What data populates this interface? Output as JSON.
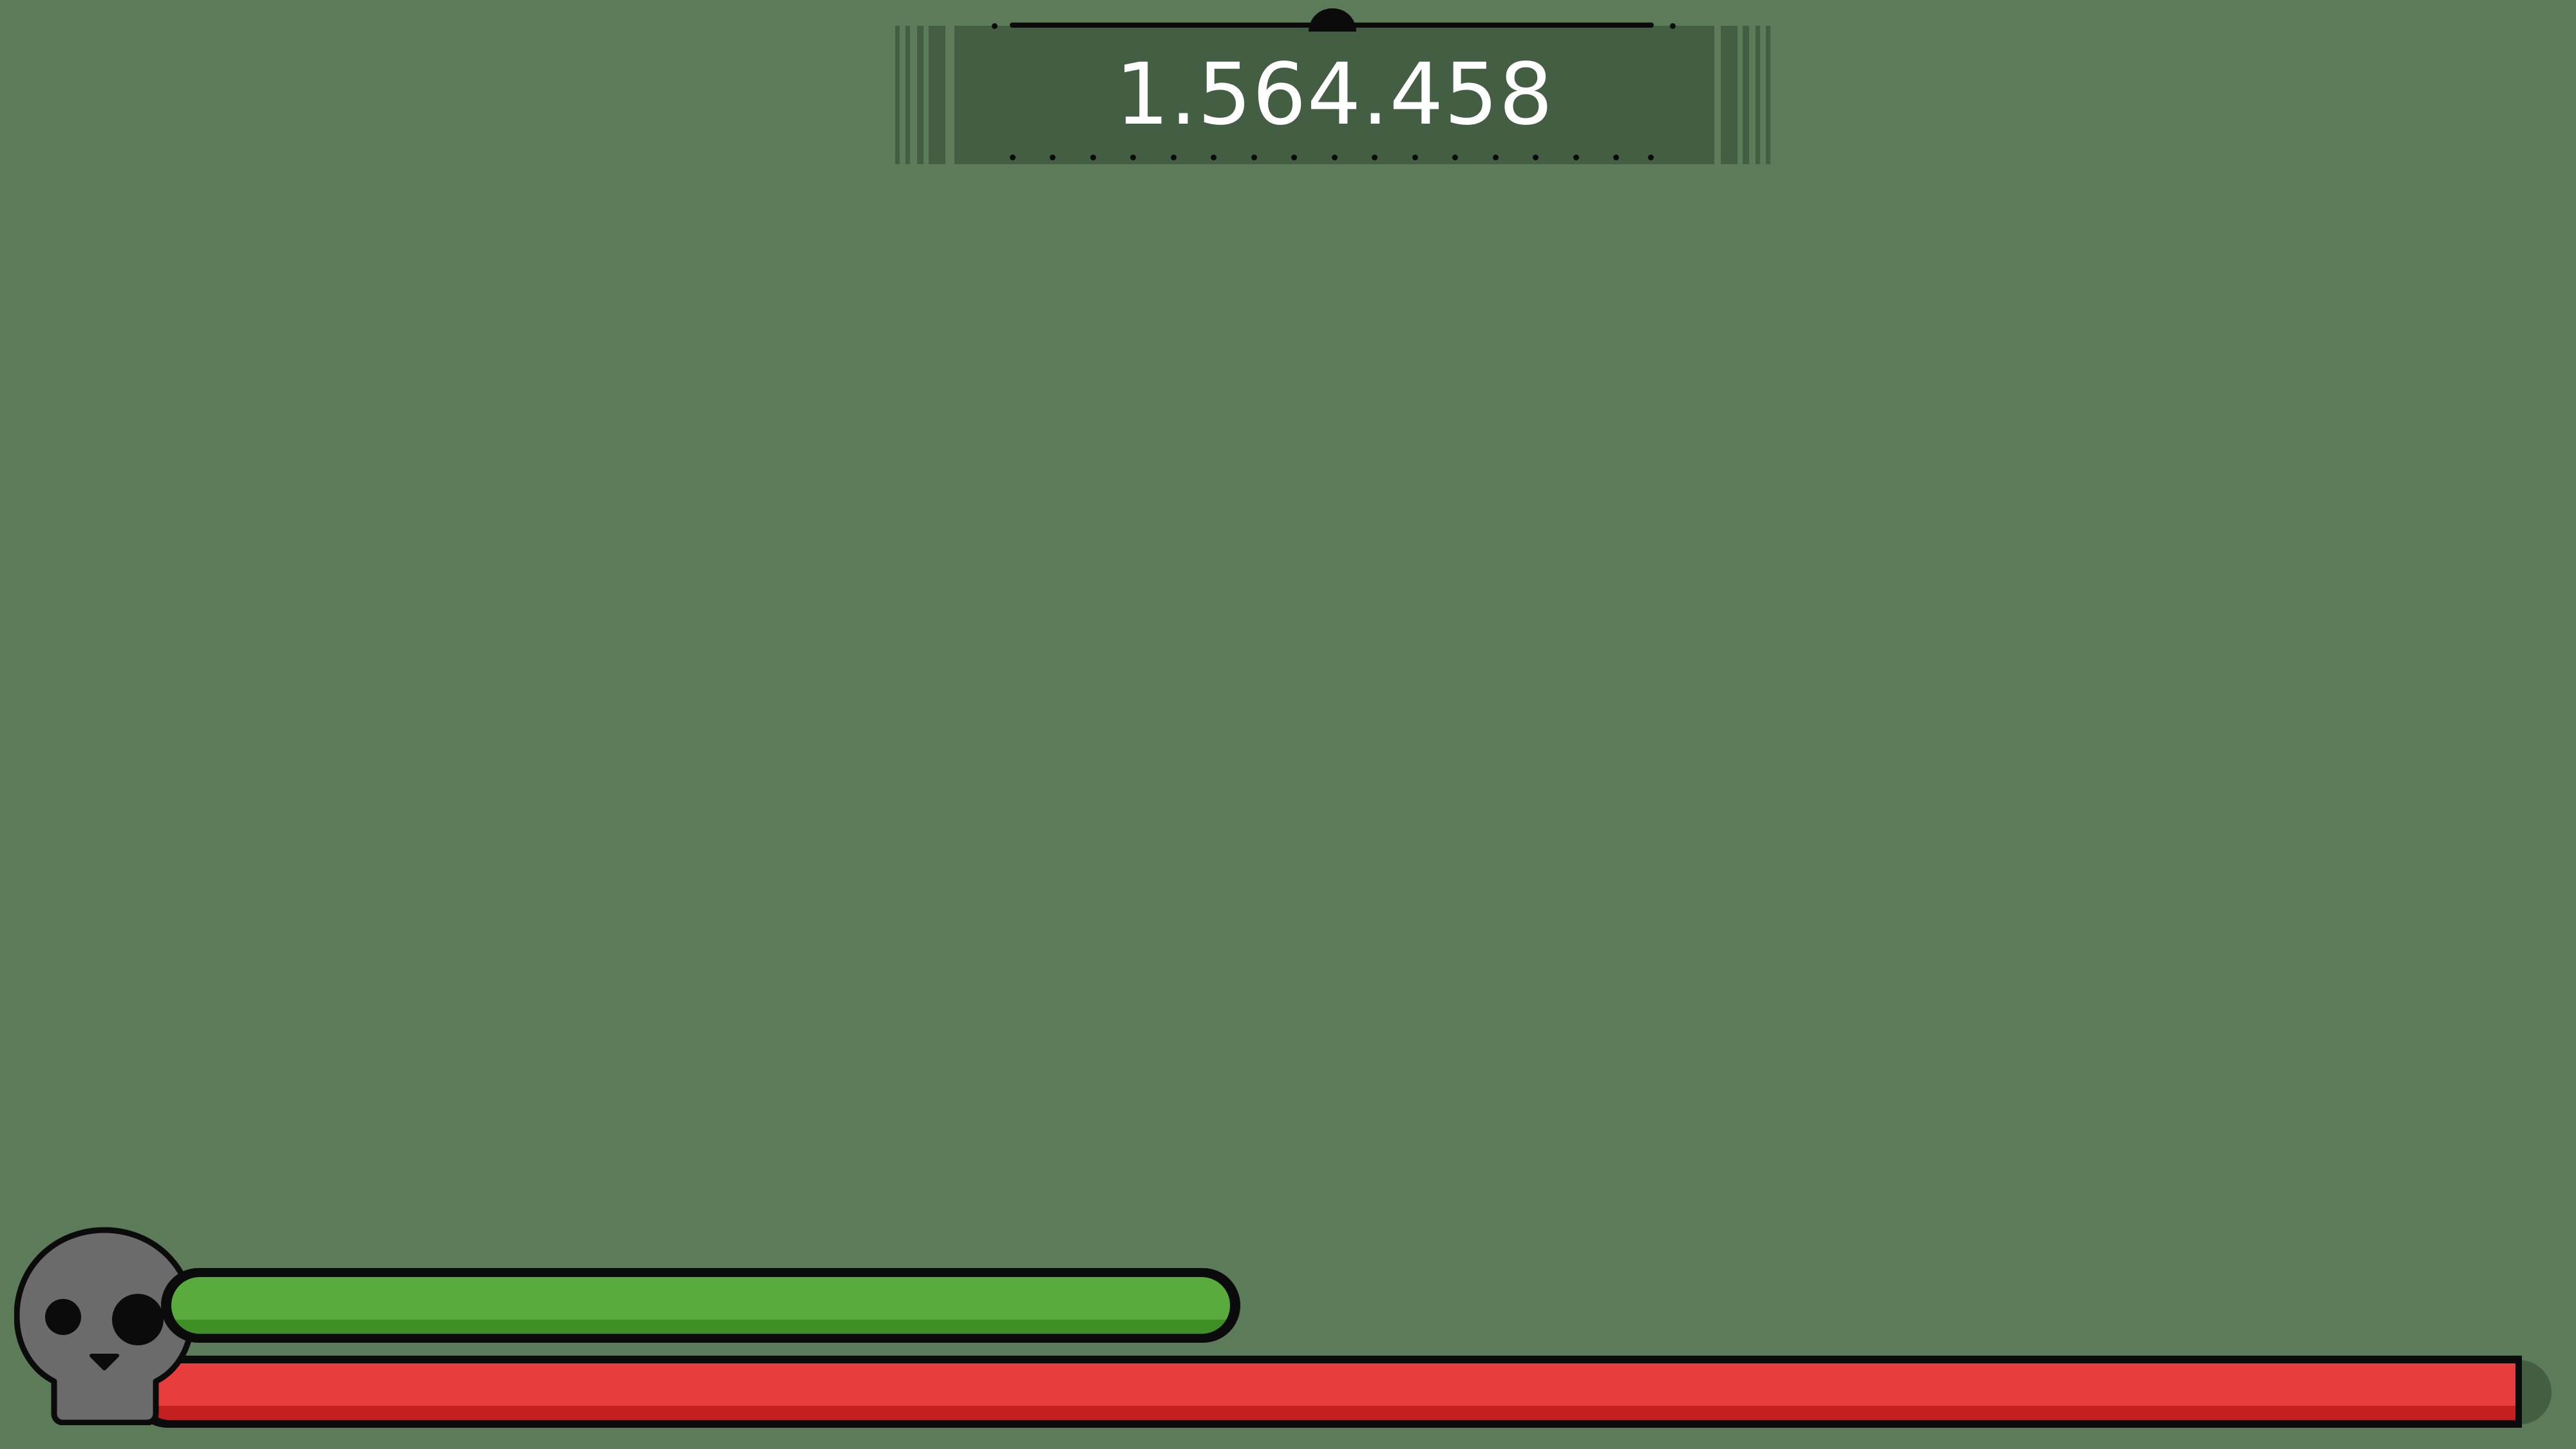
{
  "hud": {
    "score": "1.564.458",
    "stamina_level": 0.42,
    "health_level": 1.0
  },
  "icons": {
    "skull": "skull-icon"
  },
  "colors": {
    "background": "#5c7b59",
    "panel": "#445e43",
    "stamina": "#5aab3d",
    "health": "#e93c3c",
    "outline": "#0b0b0b",
    "skull": "#6b6b6b"
  }
}
